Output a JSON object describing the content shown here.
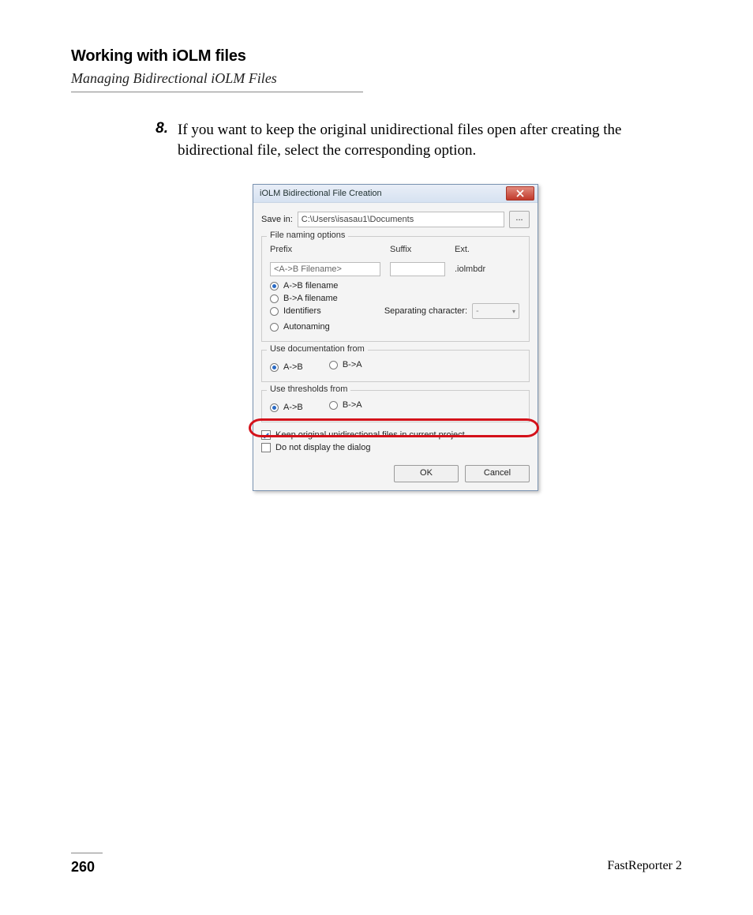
{
  "header": {
    "section_title": "Working with iOLM files",
    "subsection_title": "Managing Bidirectional iOLM Files"
  },
  "step": {
    "number": "8.",
    "text": "If you want to keep the original unidirectional files open after creating the bidirectional file, select the corresponding option."
  },
  "dialog": {
    "title": "iOLM Bidirectional File Creation",
    "save_in_label": "Save in:",
    "save_in_path": "C:\\Users\\isasau1\\Documents",
    "browse_btn": "...",
    "file_naming": {
      "group_title": "File naming options",
      "prefix_label": "Prefix",
      "suffix_label": "Suffix",
      "ext_label": "Ext.",
      "prefix_placeholder": "<A->B Filename>",
      "suffix_value": "",
      "ext_value": ".iolmbdr",
      "radio_ab": "A->B filename",
      "radio_ba": "B->A filename",
      "radio_identifiers": "Identifiers",
      "radio_autonaming": "Autonaming",
      "sep_label": "Separating character:",
      "sep_value": "-"
    },
    "doc_from": {
      "group_title": "Use documentation from",
      "radio_ab": "A->B",
      "radio_ba": "B->A"
    },
    "thresh_from": {
      "group_title": "Use thresholds from",
      "radio_ab": "A->B",
      "radio_ba": "B->A"
    },
    "checkbox_keep": "Keep original unidirectional files in current project",
    "checkbox_nodialog": "Do not display the dialog",
    "ok_label": "OK",
    "cancel_label": "Cancel"
  },
  "footer": {
    "page_number": "260",
    "product": "FastReporter 2"
  }
}
